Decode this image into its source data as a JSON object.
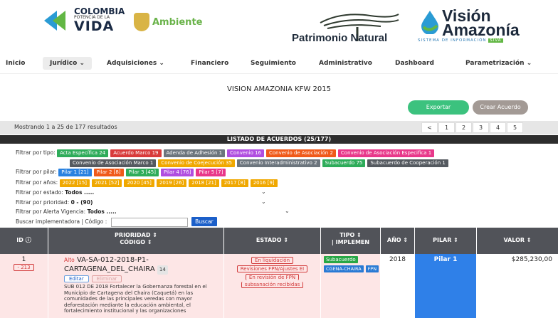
{
  "header": {
    "colombia_line1": "COLOMBIA",
    "colombia_line2": "POTENCIA DE LA",
    "colombia_line3": "VIDA",
    "ambiente": "Ambiente",
    "patrimonio": "Patrimonio",
    "natural": "Natural",
    "vision_line1": "Visión",
    "vision_line2": "Amazonía",
    "vision_sub": "SISTEMA DE INFORMACIÓN",
    "vision_sub_tag": "SIVA"
  },
  "nav": {
    "items": [
      "Inicio",
      "Jurídico ⌄",
      "Adquisiciones ⌄",
      "Financiero",
      "Seguimiento",
      "Administrativo",
      "Dashboard",
      "Parametrización ⌄"
    ]
  },
  "page_title": "VISION AMAZONIA KFW 2015",
  "actions": {
    "export": "Exportar",
    "create": "Crear Acuerdo"
  },
  "results_text": "Mostrando 1 a 25 de 177 resultados",
  "pagination": [
    "<",
    "1",
    "2",
    "3",
    "4",
    "5"
  ],
  "list_title": "LISTADO DE ACUERDOS (25/177)",
  "filters": {
    "tipo_label": "Filtrar por tipo:",
    "tipo_row1": [
      {
        "label": "Acta Específica 24",
        "color": "#2eac5a"
      },
      {
        "label": "Acuerdo Marco 19",
        "color": "#d83b3b"
      },
      {
        "label": "Adenda de Adhesión 1",
        "color": "#6c757d"
      },
      {
        "label": "Convenio 16",
        "color": "#b04ee0"
      },
      {
        "label": "Convenio de Asociación 2",
        "color": "#f05a1a"
      },
      {
        "label": "Convenio de Asociación Especifica 1",
        "color": "#e8388a"
      }
    ],
    "tipo_row2": [
      {
        "label": "Convenio de Asociación Marco 1",
        "color": "#555a60"
      },
      {
        "label": "Convenio de Coejecución 35",
        "color": "#f0a800"
      },
      {
        "label": "Convenio Interadministrativo 2",
        "color": "#6c757d"
      },
      {
        "label": "Subacuerdo 75",
        "color": "#2eac5a"
      },
      {
        "label": "Subacuerdo de Cooperación 1",
        "color": "#555a60"
      }
    ],
    "pilar_label": "Filtrar por pilar:",
    "pilar": [
      {
        "label": "Pilar 1 [21]",
        "color": "#2a82e0"
      },
      {
        "label": "Pilar 2 [8]",
        "color": "#f05a1a"
      },
      {
        "label": "Pilar 3 [45]",
        "color": "#2eac5a"
      },
      {
        "label": "Pilar 4 [76]",
        "color": "#b04ee0"
      },
      {
        "label": "Pilar 5 [7]",
        "color": "#e8388a"
      }
    ],
    "anios_label": "Filtrar por años:",
    "anios": [
      {
        "label": "2022 [15]",
        "color": "#f0a800"
      },
      {
        "label": "2021 [52]",
        "color": "#f0a800"
      },
      {
        "label": "2020 [45]",
        "color": "#f0a800"
      },
      {
        "label": "2019 [26]",
        "color": "#f0a800"
      },
      {
        "label": "2018 [21]",
        "color": "#f0a800"
      },
      {
        "label": "2017 [8]",
        "color": "#f0a800"
      },
      {
        "label": "2016 [9]",
        "color": "#f0a800"
      }
    ],
    "estado_label": "Filtrar por estado:",
    "estado_value": "Todos .....",
    "prioridad_label": "Filtrar por prioridad:",
    "prioridad_value": "0 - (90)",
    "alerta_label": "Filtrar por Alerta Vigencia:",
    "alerta_value": "Todos .....",
    "buscar_label": "Buscar implementadora | Código :",
    "buscar_button": "Buscar"
  },
  "table": {
    "headers": {
      "id": "ID ⓘ",
      "prioridad_1": "PRIORIDAD ⇕",
      "prioridad_2": "CÓDIGO ⇕",
      "estado": "ESTADO ⇕",
      "tipo_1": "TIPO ⇕",
      "tipo_2": "| IMPLEMEN",
      "anio": "AÑO ⇕",
      "pilar": "PILAR ⇕",
      "valor": "VALOR ⇕"
    },
    "row": {
      "id": "1",
      "id_badge": "- 213",
      "priority": "Alto",
      "code_1": "VA-SA-012-2018-P1-",
      "code_2": "CARTAGENA_DEL_CHAIRA",
      "count_badge": "14",
      "edit": "Editar",
      "delete": "Eliminar",
      "description": "SUB 012 DE 2018 Fortalecer la Gobernanza forestal en el Municipio de Cartagena del Chaira (Caquetá) en las comunidades de las principales veredas con mayor deforestación mediante la educación ambiental, el fortalecimiento institucional y las organizaciones comunitarias para conservar los bosques naturales y controlar la deforestación",
      "estados": [
        "En liquidación",
        "Revisiones FPN/Ajustes EI",
        "En revisión de FPN",
        "subsanación recibidas"
      ],
      "tipo": "Subacuerdo",
      "implementador": "CGENA-CHAIRA",
      "fpn": "FPN",
      "anio": "2018",
      "pilar": "Pilar 1",
      "valor": "$285,230,00"
    }
  },
  "colors": {
    "header_dark": "#515359",
    "row_bg": "#fde6e6",
    "pilar_blue": "#2f80e8",
    "export_green": "#3cc27e"
  }
}
